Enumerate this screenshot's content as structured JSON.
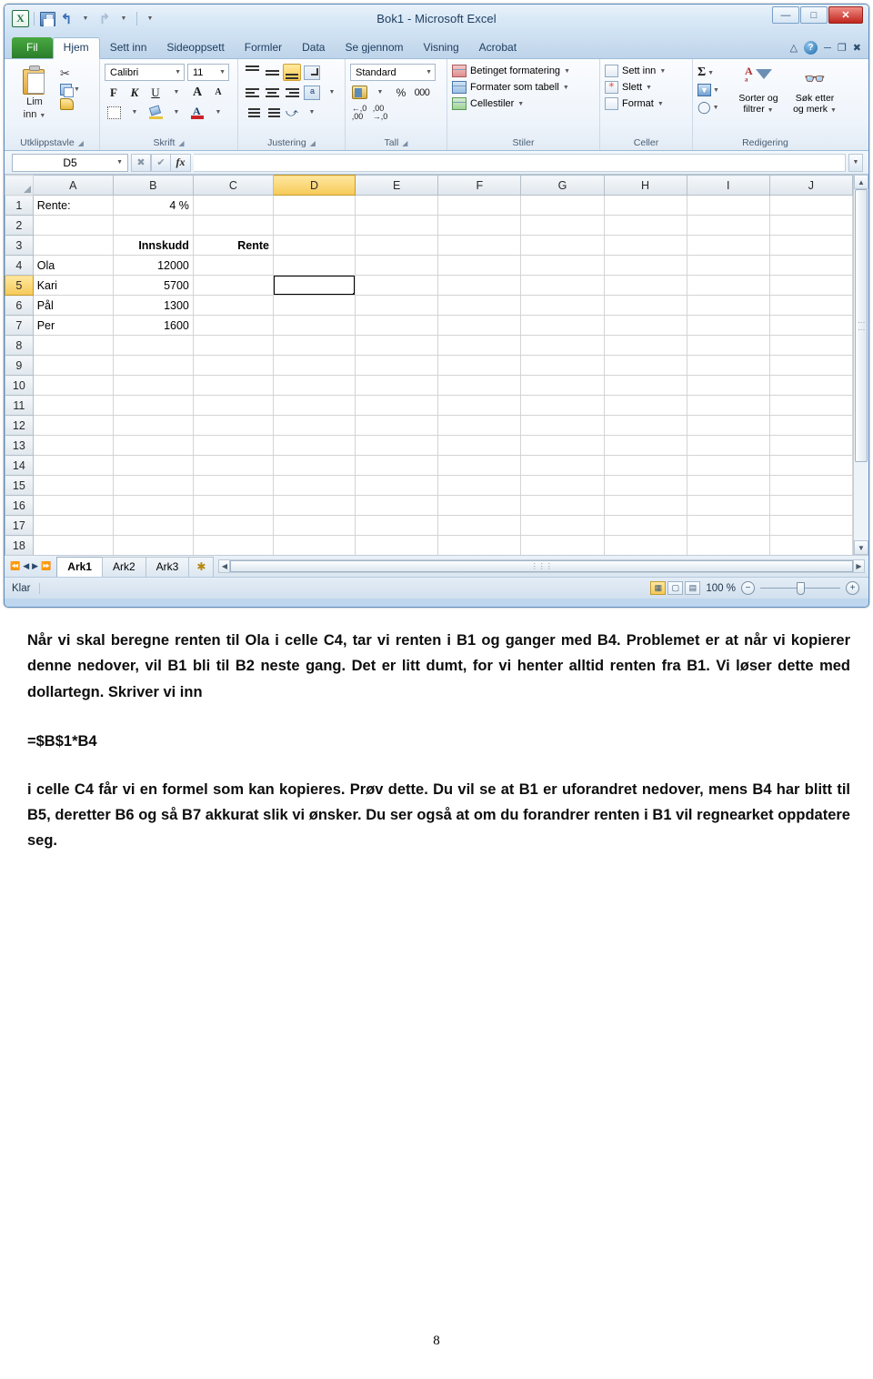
{
  "window": {
    "title": "Bok1  -  Microsoft Excel",
    "quick_access": [
      {
        "name": "excel-logo",
        "glyph": "X"
      },
      {
        "name": "save-icon",
        "glyph": ""
      },
      {
        "name": "undo-icon",
        "glyph": "↶"
      },
      {
        "name": "redo-icon",
        "glyph": "↷"
      },
      {
        "name": "customize-qat-icon",
        "glyph": "▾"
      }
    ],
    "controls": {
      "minimize": "—",
      "restore": "□",
      "close": "✕"
    }
  },
  "ribbon": {
    "tabs": [
      {
        "label": "Fil",
        "type": "file"
      },
      {
        "label": "Hjem",
        "type": "active"
      },
      {
        "label": "Sett inn",
        "type": "normal"
      },
      {
        "label": "Sideoppsett",
        "type": "normal"
      },
      {
        "label": "Formler",
        "type": "normal"
      },
      {
        "label": "Data",
        "type": "normal"
      },
      {
        "label": "Se gjennom",
        "type": "normal"
      },
      {
        "label": "Visning",
        "type": "normal"
      },
      {
        "label": "Acrobat",
        "type": "normal"
      }
    ],
    "tab_right_icons": [
      "collapse-ribbon-icon",
      "help-icon",
      "minimize-window-icon",
      "restore-window-icon",
      "close-window-icon"
    ],
    "help_glyph": "?",
    "groups": {
      "clipboard": {
        "label": "Utklippstavle",
        "paste_label": "Lim\ninn",
        "paste_line1": "Lim",
        "paste_line2": "inn",
        "cut_label": "",
        "copy_label": "",
        "format_painter_label": ""
      },
      "font": {
        "label": "Skrift",
        "font_name": "Calibri",
        "font_size": "11",
        "bold": "F",
        "italic": "K",
        "underline": "U",
        "grow_font": "A",
        "shrink_font": "A"
      },
      "alignment": {
        "label": "Justering"
      },
      "number": {
        "label": "Tall",
        "format": "Standard",
        "percent": "%",
        "thousands": "000"
      },
      "styles": {
        "label": "Stiler",
        "items": [
          "Betinget formatering",
          "Formater som tabell",
          "Cellestiler"
        ]
      },
      "cells": {
        "label": "Celler",
        "items": [
          "Sett inn",
          "Slett",
          "Format"
        ]
      },
      "editing": {
        "label": "Redigering",
        "sum_symbol": "Σ",
        "sort_filter_line1": "Sorter og",
        "sort_filter_line2": "filtrer",
        "find_select_line1": "Søk etter",
        "find_select_line2": "og merk"
      }
    }
  },
  "formula_bar": {
    "name_box": "D5",
    "formula_value": "",
    "fx_label": "fx"
  },
  "sheet": {
    "columns": [
      "A",
      "B",
      "C",
      "D",
      "E",
      "F",
      "G",
      "H",
      "I",
      "J"
    ],
    "selected_column": "D",
    "selected_row": 5,
    "selected_cell": "D5",
    "rows": [
      {
        "n": 1,
        "cells": [
          {
            "v": "Rente:",
            "a": "left"
          },
          {
            "v": "4 %",
            "a": "right"
          },
          {
            "v": ""
          },
          {
            "v": ""
          },
          {
            "v": ""
          },
          {
            "v": ""
          },
          {
            "v": ""
          },
          {
            "v": ""
          },
          {
            "v": ""
          },
          {
            "v": ""
          }
        ]
      },
      {
        "n": 2,
        "cells": [
          {
            "v": ""
          },
          {
            "v": ""
          },
          {
            "v": ""
          },
          {
            "v": ""
          },
          {
            "v": ""
          },
          {
            "v": ""
          },
          {
            "v": ""
          },
          {
            "v": ""
          },
          {
            "v": ""
          },
          {
            "v": ""
          }
        ]
      },
      {
        "n": 3,
        "cells": [
          {
            "v": ""
          },
          {
            "v": "Innskudd",
            "a": "right",
            "b": true
          },
          {
            "v": "Rente",
            "a": "right",
            "b": true
          },
          {
            "v": ""
          },
          {
            "v": ""
          },
          {
            "v": ""
          },
          {
            "v": ""
          },
          {
            "v": ""
          },
          {
            "v": ""
          },
          {
            "v": ""
          }
        ]
      },
      {
        "n": 4,
        "cells": [
          {
            "v": "Ola",
            "a": "left"
          },
          {
            "v": "12000",
            "a": "right"
          },
          {
            "v": ""
          },
          {
            "v": ""
          },
          {
            "v": ""
          },
          {
            "v": ""
          },
          {
            "v": ""
          },
          {
            "v": ""
          },
          {
            "v": ""
          },
          {
            "v": ""
          }
        ]
      },
      {
        "n": 5,
        "cells": [
          {
            "v": "Kari",
            "a": "left"
          },
          {
            "v": "5700",
            "a": "right"
          },
          {
            "v": ""
          },
          {
            "v": "",
            "sel": true
          },
          {
            "v": ""
          },
          {
            "v": ""
          },
          {
            "v": ""
          },
          {
            "v": ""
          },
          {
            "v": ""
          },
          {
            "v": ""
          }
        ]
      },
      {
        "n": 6,
        "cells": [
          {
            "v": "Pål",
            "a": "left"
          },
          {
            "v": "1300",
            "a": "right"
          },
          {
            "v": ""
          },
          {
            "v": ""
          },
          {
            "v": ""
          },
          {
            "v": ""
          },
          {
            "v": ""
          },
          {
            "v": ""
          },
          {
            "v": ""
          },
          {
            "v": ""
          }
        ]
      },
      {
        "n": 7,
        "cells": [
          {
            "v": "Per",
            "a": "left"
          },
          {
            "v": "1600",
            "a": "right"
          },
          {
            "v": ""
          },
          {
            "v": ""
          },
          {
            "v": ""
          },
          {
            "v": ""
          },
          {
            "v": ""
          },
          {
            "v": ""
          },
          {
            "v": ""
          },
          {
            "v": ""
          }
        ]
      },
      {
        "n": 8,
        "cells": [
          {
            "v": ""
          },
          {
            "v": ""
          },
          {
            "v": ""
          },
          {
            "v": ""
          },
          {
            "v": ""
          },
          {
            "v": ""
          },
          {
            "v": ""
          },
          {
            "v": ""
          },
          {
            "v": ""
          },
          {
            "v": ""
          }
        ]
      },
      {
        "n": 9,
        "cells": [
          {
            "v": ""
          },
          {
            "v": ""
          },
          {
            "v": ""
          },
          {
            "v": ""
          },
          {
            "v": ""
          },
          {
            "v": ""
          },
          {
            "v": ""
          },
          {
            "v": ""
          },
          {
            "v": ""
          },
          {
            "v": ""
          }
        ]
      },
      {
        "n": 10,
        "cells": [
          {
            "v": ""
          },
          {
            "v": ""
          },
          {
            "v": ""
          },
          {
            "v": ""
          },
          {
            "v": ""
          },
          {
            "v": ""
          },
          {
            "v": ""
          },
          {
            "v": ""
          },
          {
            "v": ""
          },
          {
            "v": ""
          }
        ]
      },
      {
        "n": 11,
        "cells": [
          {
            "v": ""
          },
          {
            "v": ""
          },
          {
            "v": ""
          },
          {
            "v": ""
          },
          {
            "v": ""
          },
          {
            "v": ""
          },
          {
            "v": ""
          },
          {
            "v": ""
          },
          {
            "v": ""
          },
          {
            "v": ""
          }
        ]
      },
      {
        "n": 12,
        "cells": [
          {
            "v": ""
          },
          {
            "v": ""
          },
          {
            "v": ""
          },
          {
            "v": ""
          },
          {
            "v": ""
          },
          {
            "v": ""
          },
          {
            "v": ""
          },
          {
            "v": ""
          },
          {
            "v": ""
          },
          {
            "v": ""
          }
        ]
      },
      {
        "n": 13,
        "cells": [
          {
            "v": ""
          },
          {
            "v": ""
          },
          {
            "v": ""
          },
          {
            "v": ""
          },
          {
            "v": ""
          },
          {
            "v": ""
          },
          {
            "v": ""
          },
          {
            "v": ""
          },
          {
            "v": ""
          },
          {
            "v": ""
          }
        ]
      },
      {
        "n": 14,
        "cells": [
          {
            "v": ""
          },
          {
            "v": ""
          },
          {
            "v": ""
          },
          {
            "v": ""
          },
          {
            "v": ""
          },
          {
            "v": ""
          },
          {
            "v": ""
          },
          {
            "v": ""
          },
          {
            "v": ""
          },
          {
            "v": ""
          }
        ]
      },
      {
        "n": 15,
        "cells": [
          {
            "v": ""
          },
          {
            "v": ""
          },
          {
            "v": ""
          },
          {
            "v": ""
          },
          {
            "v": ""
          },
          {
            "v": ""
          },
          {
            "v": ""
          },
          {
            "v": ""
          },
          {
            "v": ""
          },
          {
            "v": ""
          }
        ]
      },
      {
        "n": 16,
        "cells": [
          {
            "v": ""
          },
          {
            "v": ""
          },
          {
            "v": ""
          },
          {
            "v": ""
          },
          {
            "v": ""
          },
          {
            "v": ""
          },
          {
            "v": ""
          },
          {
            "v": ""
          },
          {
            "v": ""
          },
          {
            "v": ""
          }
        ]
      },
      {
        "n": 17,
        "cells": [
          {
            "v": ""
          },
          {
            "v": ""
          },
          {
            "v": ""
          },
          {
            "v": ""
          },
          {
            "v": ""
          },
          {
            "v": ""
          },
          {
            "v": ""
          },
          {
            "v": ""
          },
          {
            "v": ""
          },
          {
            "v": ""
          }
        ]
      },
      {
        "n": 18,
        "cells": [
          {
            "v": ""
          },
          {
            "v": ""
          },
          {
            "v": ""
          },
          {
            "v": ""
          },
          {
            "v": ""
          },
          {
            "v": ""
          },
          {
            "v": ""
          },
          {
            "v": ""
          },
          {
            "v": ""
          },
          {
            "v": ""
          }
        ]
      }
    ]
  },
  "sheet_tabs": {
    "nav": [
      "⏮",
      "◀",
      "▶",
      "⏭"
    ],
    "tabs": [
      {
        "label": "Ark1",
        "active": true
      },
      {
        "label": "Ark2",
        "active": false
      },
      {
        "label": "Ark3",
        "active": false
      }
    ],
    "insert_sheet_label": "✱"
  },
  "status_bar": {
    "status": "Klar",
    "zoom": "100 %",
    "view_buttons": [
      "normal-view-icon",
      "page-layout-view-icon",
      "page-break-view-icon"
    ],
    "zoom_out": "−",
    "zoom_in": "+"
  },
  "document": {
    "paragraph1": "Når vi skal beregne renten til Ola i celle C4, tar vi renten i B1 og ganger med B4. Problemet er at når vi kopierer denne nedover, vil B1 bli til B2 neste gang. Det er litt dumt, for vi henter alltid renten fra B1. Vi løser dette med dollartegn. Skriver vi inn",
    "formula": "=$B$1*B4",
    "paragraph2": "i celle C4 får vi en formel som kan kopieres. Prøv dette. Du vil se at B1 er uforandret nedover, mens B4 har blitt til B5, deretter B6 og så B7 akkurat slik vi ønsker. Du ser også at om du forandrer renten i B1 vil regnearket oppdatere seg.",
    "page_number": "8"
  }
}
